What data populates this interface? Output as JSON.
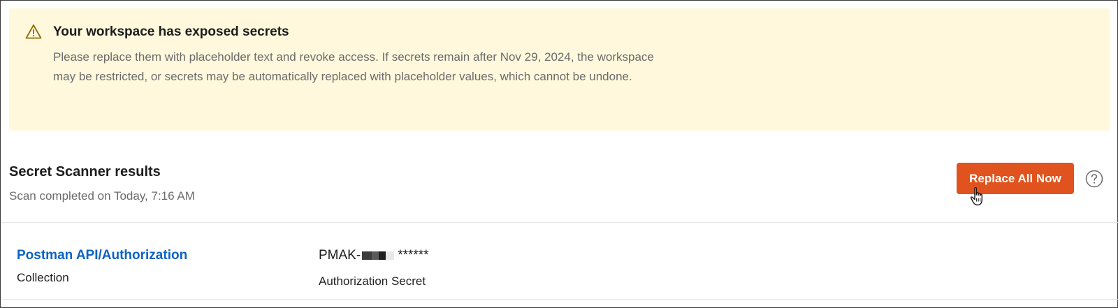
{
  "banner": {
    "icon": "warning-triangle-icon",
    "title": "Your workspace has exposed secrets",
    "body": "Please replace them with placeholder text and revoke access. If secrets remain after Nov 29, 2024, the workspace may be restricted, or secrets may be automatically replaced with placeholder values, which cannot be undone.",
    "background": "#fff8dd"
  },
  "results": {
    "title": "Secret Scanner results",
    "subtitle": "Scan completed on Today, 7:16 AM",
    "replace_button_label": "Replace All Now",
    "replace_button_color": "#e0531f",
    "help_icon": "question-circle-icon",
    "cursor_icon": "hand-pointer-icon"
  },
  "items": [
    {
      "name": "Postman API/Authorization",
      "type": "Collection",
      "secret_prefix": "PMAK-",
      "secret_mask": "******",
      "secret_label": "Authorization Secret"
    }
  ],
  "colors": {
    "link": "#0b63c4",
    "muted_text": "#6b6b6b"
  }
}
